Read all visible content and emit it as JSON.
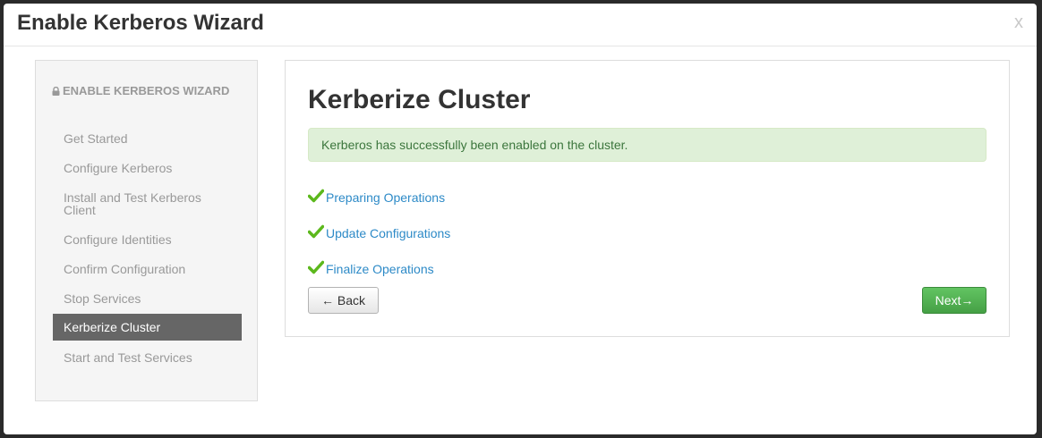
{
  "modal": {
    "title": "Enable Kerberos Wizard",
    "close_label": "x"
  },
  "sidebar": {
    "header": "ENABLE KERBEROS WIZARD",
    "items": [
      {
        "label": "Get Started",
        "active": false
      },
      {
        "label": "Configure Kerberos",
        "active": false
      },
      {
        "label": "Install and Test Kerberos Client",
        "active": false
      },
      {
        "label": "Configure Identities",
        "active": false
      },
      {
        "label": "Confirm Configuration",
        "active": false
      },
      {
        "label": "Stop Services",
        "active": false
      },
      {
        "label": "Kerberize Cluster",
        "active": true
      },
      {
        "label": "Start and Test Services",
        "active": false
      }
    ]
  },
  "main": {
    "title": "Kerberize Cluster",
    "alert": "Kerberos has successfully been enabled on the cluster.",
    "operations": [
      {
        "label": "Preparing Operations",
        "status": "done"
      },
      {
        "label": "Update Configurations",
        "status": "done"
      },
      {
        "label": "Finalize Operations",
        "status": "done"
      }
    ],
    "back_label": "← Back",
    "next_label": "Next→"
  },
  "colors": {
    "success_check": "#5cb81c",
    "link": "#2d8ac7",
    "active_nav_bg": "#666666",
    "next_button": "#51a351"
  },
  "icons": {
    "lock": "lock-icon",
    "check": "check-icon"
  }
}
